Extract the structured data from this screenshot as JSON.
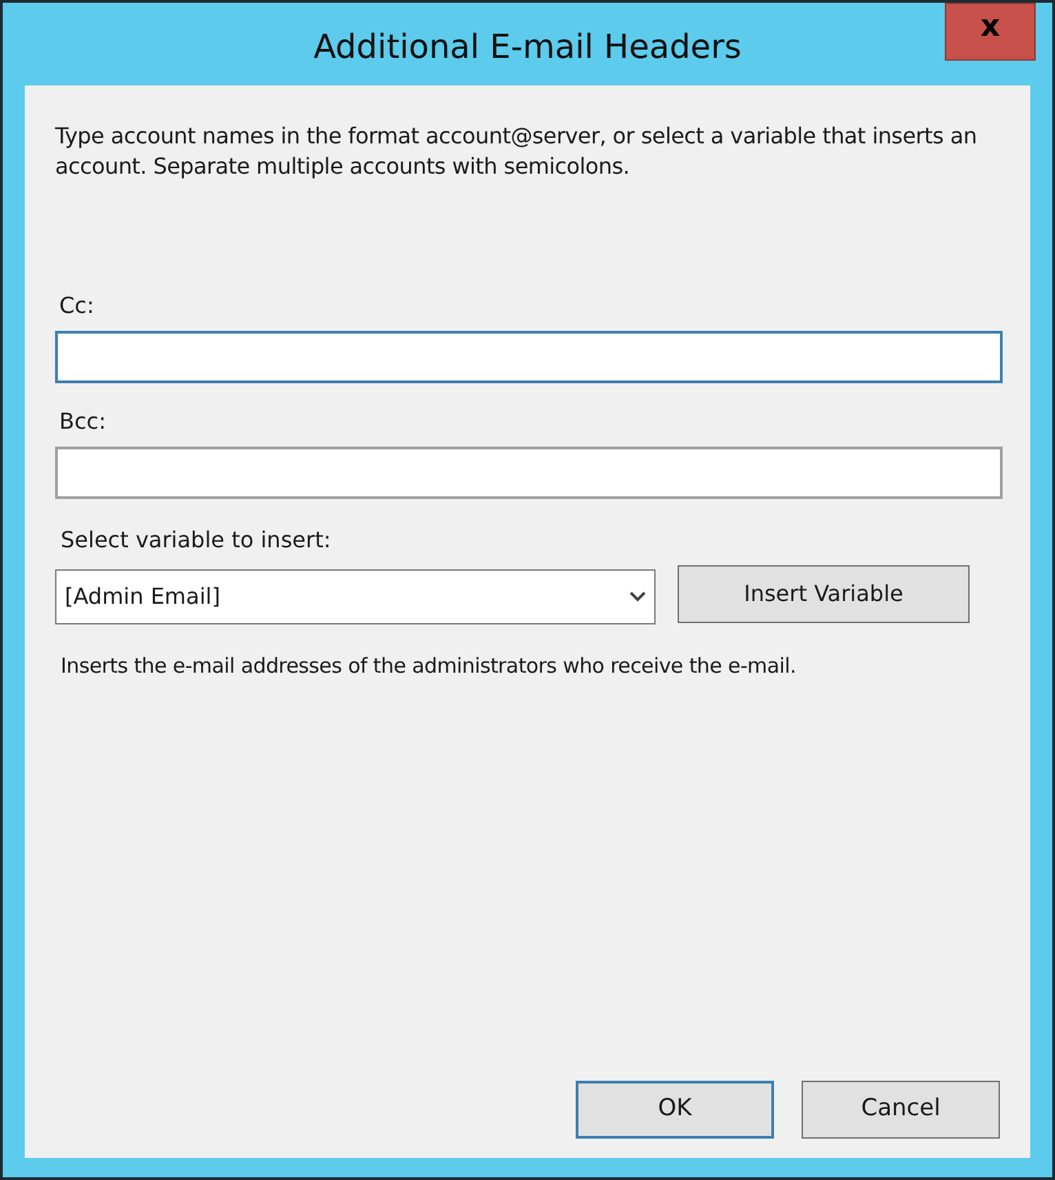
{
  "window": {
    "title": "Additional E-mail Headers",
    "close_label": "x"
  },
  "instructions": "Type account names in the format account@server, or select a variable that inserts an account. Separate multiple accounts with semicolons.",
  "fields": [
    {
      "label": "Cc:",
      "focused": true
    },
    {
      "label": "Bcc:",
      "focused": false
    }
  ],
  "variable": {
    "label": "Select variable to insert:",
    "value": "[Admin Email]",
    "button": "Insert Variable",
    "description": "Inserts the e-mail addresses of the administrators who receive the e-mail."
  },
  "buttons": [
    {
      "label": "OK",
      "default": true
    },
    {
      "label": "Cancel",
      "default": false
    }
  ]
}
